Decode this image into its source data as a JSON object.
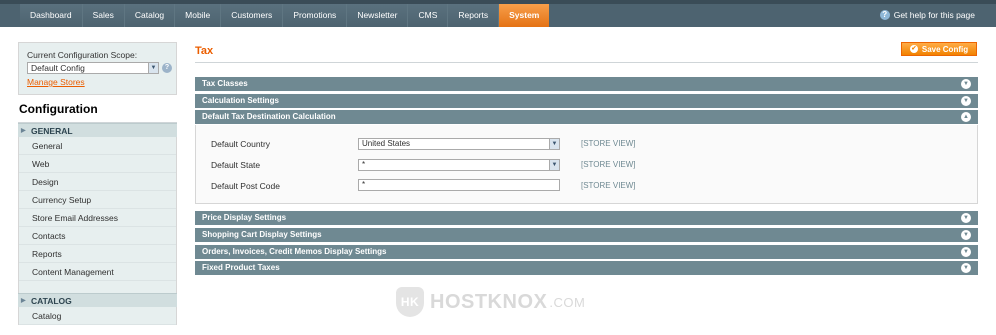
{
  "topnav": {
    "items": [
      "Dashboard",
      "Sales",
      "Catalog",
      "Mobile",
      "Customers",
      "Promotions",
      "Newsletter",
      "CMS",
      "Reports",
      "System"
    ],
    "active": "System",
    "help": "Get help for this page"
  },
  "sidebar": {
    "scope_label": "Current Configuration Scope:",
    "scope_value": "Default Config",
    "manage_stores": "Manage Stores",
    "title": "Configuration",
    "groups": [
      {
        "name": "GENERAL",
        "items": [
          "General",
          "Web",
          "Design",
          "Currency Setup",
          "Store Email Addresses",
          "Contacts",
          "Reports",
          "Content Management"
        ]
      },
      {
        "name": "CATALOG",
        "items": [
          "Catalog"
        ]
      }
    ]
  },
  "main": {
    "title": "Tax",
    "save_button": "Save Config",
    "sections_top": [
      "Tax Classes",
      "Calculation Settings"
    ],
    "open_section": "Default Tax Destination Calculation",
    "fields": [
      {
        "label": "Default Country",
        "value": "United States",
        "type": "select",
        "scope": "[STORE VIEW]"
      },
      {
        "label": "Default State",
        "value": "*",
        "type": "select",
        "scope": "[STORE VIEW]"
      },
      {
        "label": "Default Post Code",
        "value": "*",
        "type": "text",
        "scope": "[STORE VIEW]"
      }
    ],
    "sections_bottom": [
      "Price Display Settings",
      "Shopping Cart Display Settings",
      "Orders, Invoices, Credit Memos Display Settings",
      "Fixed Product Taxes"
    ]
  },
  "watermark": {
    "brand": "HOSTKNOX",
    "suffix": ".COM"
  },
  "colors": {
    "accent": "#eb5e00",
    "nav": "#4d6370",
    "section": "#6f8992"
  }
}
